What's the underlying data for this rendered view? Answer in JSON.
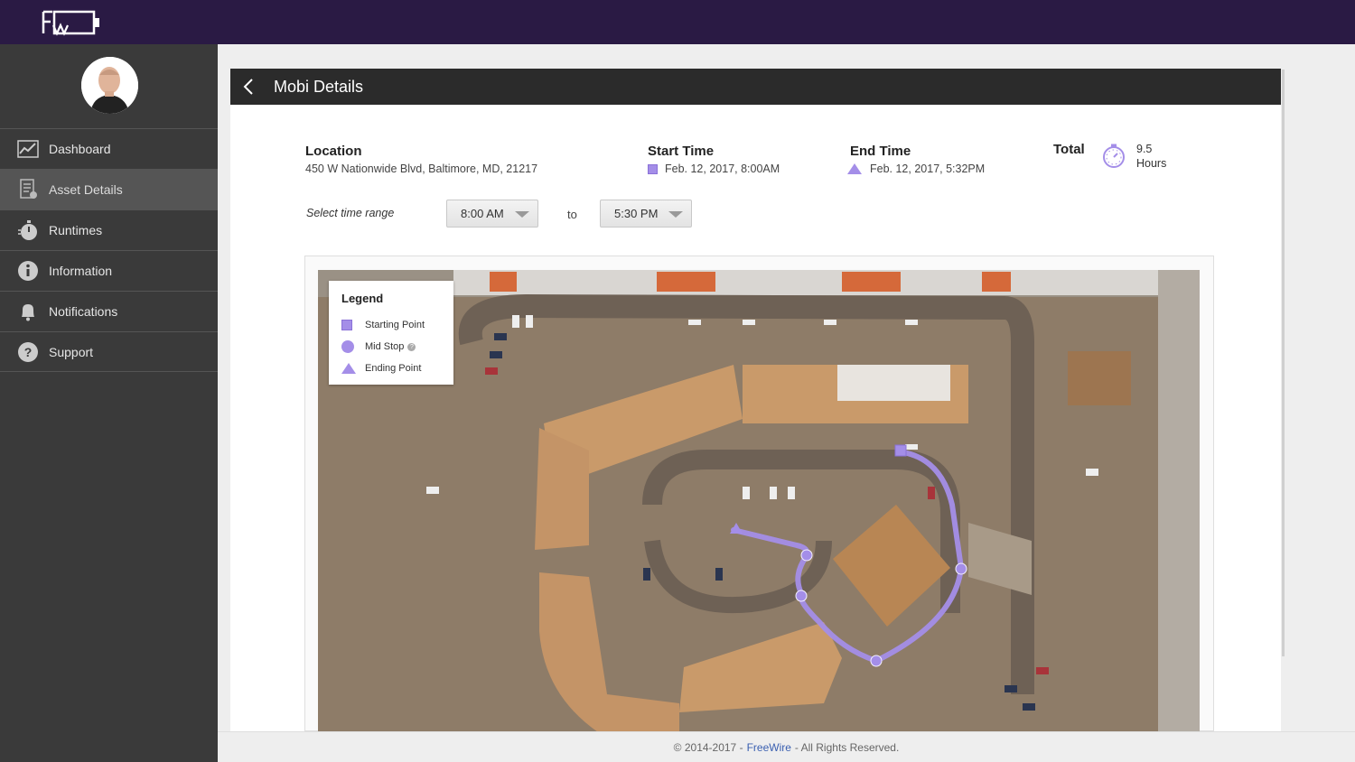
{
  "app": {
    "logo": "logo-icon"
  },
  "sidebar": {
    "items": [
      {
        "label": "Dashboard",
        "icon": "chart-icon",
        "active": false
      },
      {
        "label": "Asset Details",
        "icon": "document-icon",
        "active": true
      },
      {
        "label": "Runtimes",
        "icon": "stopwatch-icon",
        "active": false
      },
      {
        "label": "Information",
        "icon": "info-icon",
        "active": false
      },
      {
        "label": "Notifications",
        "icon": "bell-icon",
        "active": false
      },
      {
        "label": "Support",
        "icon": "question-icon",
        "active": false
      }
    ]
  },
  "header": {
    "title": "Mobi Details"
  },
  "details": {
    "location_label": "Location",
    "location_value": "450 W Nationwide Blvd, Baltimore, MD, 21217",
    "start_label": "Start Time",
    "start_value": "Feb. 12, 2017, 8:00AM",
    "end_label": "End Time",
    "end_value": "Feb. 12, 2017, 5:32PM",
    "total_label": "Total",
    "total_value": "9.5",
    "total_unit": "Hours"
  },
  "range": {
    "label": "Select time range",
    "from": "8:00 AM",
    "to_label": "to",
    "to": "5:30 PM"
  },
  "legend": {
    "title": "Legend",
    "start": "Starting Point",
    "mid": "Mid Stop",
    "end": "Ending Point"
  },
  "colors": {
    "accent": "#a48ee8",
    "topbar": "#2a1a44",
    "sidebar": "#3a3a3a"
  },
  "footer": {
    "prefix": "© 2014-2017 -",
    "brand": "FreeWire",
    "suffix": "- All Rights Reserved."
  }
}
